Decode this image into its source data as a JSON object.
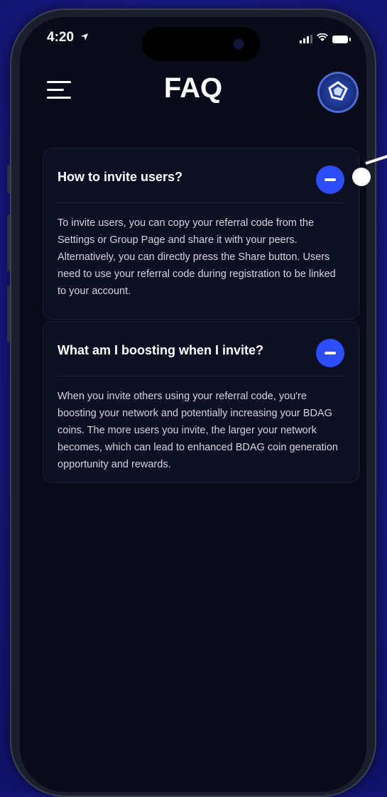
{
  "status": {
    "time": "4:20"
  },
  "header": {
    "title": "FAQ"
  },
  "faq": [
    {
      "question": "How to invite users?",
      "answer": "To invite users, you can copy your referral code from the Settings or Group Page and share it with your peers. Alternatively, you can directly press the Share button. Users need to use your referral code during registration to be linked to your account."
    },
    {
      "question": "What am I boosting when I invite?",
      "answer": "When you invite others using your referral code, you're boosting your network and potentially increasing your BDAG coins. The more users you invite, the larger your network becomes, which can lead to enhanced BDAG coin generation opportunity and rewards."
    }
  ],
  "colors": {
    "accent": "#2d4dfa",
    "background": "#0a0b1a",
    "frame_glow": "#1a1d8c"
  }
}
